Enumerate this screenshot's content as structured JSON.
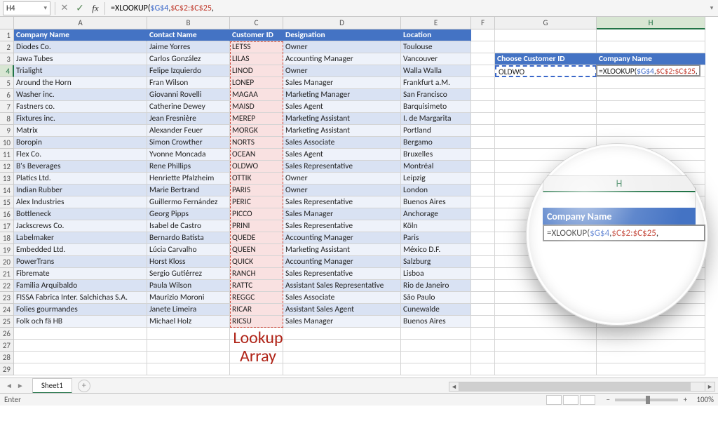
{
  "formula_bar": {
    "cell_ref": "H4",
    "formula_plain": "=XLOOKUP($G$4,$C$2:$C$25,",
    "cancel_glyph": "✕",
    "confirm_glyph": "✓",
    "fx_glyph": "fx",
    "chevron_glyph": "▾",
    "expand_glyph": "▾"
  },
  "columns": [
    "A",
    "B",
    "C",
    "D",
    "E",
    "F",
    "G",
    "H"
  ],
  "active_col": "H",
  "active_row": 4,
  "row_count": 29,
  "table": {
    "headers": {
      "company": "Company Name",
      "contact": "Contact Name",
      "cust": "Customer ID",
      "desig": "Designation",
      "loc": "Location"
    },
    "rows": [
      {
        "company": "Diodes Co.",
        "contact": "Jaime Yorres",
        "cust": "LETSS",
        "desig": "Owner",
        "loc": "Toulouse"
      },
      {
        "company": "Jawa Tubes",
        "contact": "Carlos González",
        "cust": "LILAS",
        "desig": "Accounting Manager",
        "loc": "Vancouver"
      },
      {
        "company": "Trialight",
        "contact": "Felipe Izquierdo",
        "cust": "LINOD",
        "desig": "Owner",
        "loc": "Walla Walla"
      },
      {
        "company": "Around the Horn",
        "contact": "Fran Wilson",
        "cust": "LONEP",
        "desig": "Sales Manager",
        "loc": "Frankfurt a.M."
      },
      {
        "company": "Washer inc.",
        "contact": "Giovanni Rovelli",
        "cust": "MAGAA",
        "desig": "Marketing Manager",
        "loc": "San Francisco"
      },
      {
        "company": "Fastners co.",
        "contact": "Catherine Dewey",
        "cust": "MAISD",
        "desig": "Sales Agent",
        "loc": "Barquisimeto"
      },
      {
        "company": "Fixtures inc.",
        "contact": "Jean Fresnière",
        "cust": "MEREP",
        "desig": "Marketing Assistant",
        "loc": "I. de Margarita"
      },
      {
        "company": "Matrix",
        "contact": "Alexander Feuer",
        "cust": "MORGK",
        "desig": "Marketing Assistant",
        "loc": "Portland"
      },
      {
        "company": "Boropin",
        "contact": "Simon Crowther",
        "cust": "NORTS",
        "desig": "Sales Associate",
        "loc": "Bergamo"
      },
      {
        "company": "Flex Co.",
        "contact": "Yvonne Moncada",
        "cust": "OCEAN",
        "desig": "Sales Agent",
        "loc": "Bruxelles"
      },
      {
        "company": "B's Beverages",
        "contact": "Rene Phillips",
        "cust": "OLDWO",
        "desig": "Sales Representative",
        "loc": "Montréal"
      },
      {
        "company": "Platics Ltd.",
        "contact": "Henriette Pfalzheim",
        "cust": "OTTIK",
        "desig": "Owner",
        "loc": "Leipzig"
      },
      {
        "company": "Indian Rubber",
        "contact": "Marie Bertrand",
        "cust": "PARIS",
        "desig": "Owner",
        "loc": "London"
      },
      {
        "company": "Alex Industries",
        "contact": "Guillermo Fernández",
        "cust": "PERIC",
        "desig": "Sales Representative",
        "loc": "Buenos Aires"
      },
      {
        "company": "Bottleneck",
        "contact": "Georg Pipps",
        "cust": "PICCO",
        "desig": "Sales Manager",
        "loc": "Anchorage"
      },
      {
        "company": "Jackscrews Co.",
        "contact": "Isabel de Castro",
        "cust": "PRINI",
        "desig": "Sales Representative",
        "loc": "Köln"
      },
      {
        "company": "Labelmaker",
        "contact": "Bernardo Batista",
        "cust": "QUEDE",
        "desig": "Accounting Manager",
        "loc": "Paris"
      },
      {
        "company": "Embedded Ltd.",
        "contact": "Lúcia Carvalho",
        "cust": "QUEEN",
        "desig": "Marketing Assistant",
        "loc": "México D.F."
      },
      {
        "company": "PowerTrans",
        "contact": "Horst Kloss",
        "cust": "QUICK",
        "desig": "Accounting Manager",
        "loc": "Salzburg"
      },
      {
        "company": "Fibremate",
        "contact": "Sergio Gutiérrez",
        "cust": "RANCH",
        "desig": "Sales Representative",
        "loc": "Lisboa"
      },
      {
        "company": "Familia Arquibaldo",
        "contact": "Paula Wilson",
        "cust": "RATTC",
        "desig": "Assistant Sales Representative",
        "loc": "Rio de Janeiro"
      },
      {
        "company": "FISSA Fabrica Inter. Salchichas S.A.",
        "contact": "Maurizio Moroni",
        "cust": "REGGC",
        "desig": "Sales Associate",
        "loc": "São Paulo"
      },
      {
        "company": "Folies gourmandes",
        "contact": "Janete Limeira",
        "cust": "RICAR",
        "desig": "Assistant Sales Agent",
        "loc": "Cunewalde"
      },
      {
        "company": "Folk och fä HB",
        "contact": "Michael Holz",
        "cust": "RICSU",
        "desig": "Sales Manager",
        "loc": "Buenos Aires"
      }
    ]
  },
  "side": {
    "choose_label": "Choose Customer ID",
    "company_label": "Company Name",
    "lookup_value": "OLDWO",
    "formula_parts": {
      "prefix": "=XLOOKUP(",
      "abs": "$G$4",
      "sep": ",",
      "rng": "$C$2:$C$25",
      "suffix": ","
    }
  },
  "annotation": {
    "line1": "Lookup",
    "line2": "Array"
  },
  "magnifier": {
    "col_label": "H",
    "header": "Company Name",
    "formula_parts": {
      "prefix": "=XLOOKUP(",
      "abs": "$G$4",
      "sep": ",",
      "rng": "$C$2:$C$25",
      "suffix": ","
    }
  },
  "tabs": {
    "sheet1": "Sheet1",
    "add_glyph": "+",
    "nav_first": "◄",
    "nav_last": "►"
  },
  "status": {
    "mode": "Enter",
    "zoom": "100%",
    "minus": "−",
    "plus": "+"
  }
}
